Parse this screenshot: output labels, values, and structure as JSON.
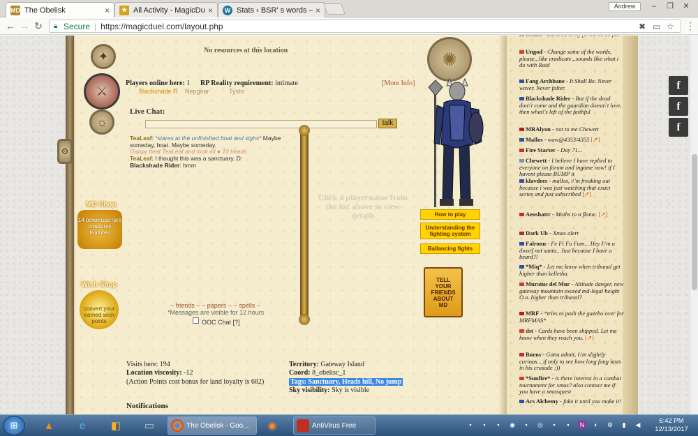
{
  "browser": {
    "tabs": [
      {
        "title": "The Obelisk",
        "icon": "magicduel-favicon"
      },
      {
        "title": "All Activity - MagicDuel F",
        "icon": "magicduel-favicon"
      },
      {
        "title": "Stats ‹ BSR' s words — W",
        "icon": "wordpress-icon"
      }
    ],
    "profile": "Andrew",
    "secure_label": "Secure",
    "url": "https://magicduel.com/layout.php"
  },
  "page": {
    "no_resources": "No resources at this location",
    "players_online_label": "Players online here:",
    "players_online_count": "1",
    "rp_label": "RP Reality requirement:",
    "rp_value": "intimate",
    "more_info": "[More Info]",
    "players": [
      "Blackshade R",
      "Nepgear",
      "Tyshr"
    ],
    "live_chat_label": "Live Chat:",
    "talk_label": "talk",
    "chat": [
      {
        "who": "TeaLeaf",
        "action": "*stares at the unfinished boat and sighs*",
        "text": " Maybe someday, boat. Maybe someday."
      },
      {
        "system": "Gappy beat TeaLeaf and took all ● 10 heads"
      },
      {
        "who": "TeaLeaf",
        "text": " I thought this was a sanctuary. D:"
      },
      {
        "who": "Blackshade Rider",
        "text": " hmm"
      }
    ],
    "click_hint": "Click a playername from the list above to view details",
    "friends_links": "~ friends ~ ~ papers ~ ~ spells ~",
    "messages_visible": "*Messages are visible for 12 hours",
    "ooc_label": "OOC Chat [?]",
    "md_shop": {
      "title": "MD Shop",
      "body": "14 powerups rare creatures features"
    },
    "wish_shop": {
      "title": "Wish Shop",
      "body": "convert your earned wish points"
    },
    "menu": {
      "how_to_play": "How to play",
      "fighting": "Understanding the fighting system",
      "ballancing": "Ballancing fights",
      "tell_friends": "TELL\nYOUR\nFRIENDS\nABOUT\nMD"
    },
    "location": {
      "visits": "Visits here: 194",
      "viscosity_label": "Location viscosity:",
      "viscosity_value": "-12",
      "ap_bonus": "(Action Points cost bonus for land loyalty is 682)",
      "territory_label": "Territory:",
      "territory_value": "Gateway Island",
      "coord_label": "Coord:",
      "coord_value": "8_obelisc_1",
      "tags": "Tags: Sanctuary, Heads hill, No jump",
      "sky_label": "Sky visibility:",
      "sky_value": "Sky is visible"
    },
    "notifications": "Notifications"
  },
  "activity": [
    {
      "name": "Ledah",
      "msg": "- Battered is my favourite so far.",
      "flag": "#c03030"
    },
    {
      "name": "Ungod",
      "msg": "- Change some of the words, please...like eradicate...sounds like what i do with Raid",
      "flag": "#d04030"
    },
    {
      "name": "Fang Archbane",
      "msg": "- It Shall Be. Never waver. Never falter.",
      "flag": "#3050a0"
    },
    {
      "name": "Blackshade Rider",
      "msg": "- But if the dead don\\'t come and the guardian doesn\\'t love, then what\\'s left of the faithful",
      "flag": "#3050a0"
    },
    {
      "name": "MRAlyon",
      "msg": "- not to me Chewett",
      "flag": "#b02020"
    },
    {
      "name": "Mallos",
      "msg": "- wow@4353/4355",
      "flag": "#3050a0",
      "ext": "[↗]"
    },
    {
      "name": "Fire Starter",
      "msg": "- Day 71...",
      "flag": "#c03030"
    },
    {
      "name": "Chewett",
      "msg": "- I believe I have replied to everyone on forum and ingame now! if I havent please BUMP it",
      "flag": "#8090c0"
    },
    {
      "name": "klavdees",
      "msg": "- mallos, i\\'m freaking out because i was just watching that exact series and just subscribed",
      "flag": "#3050a0",
      "ext": "[↗]"
    },
    {
      "name": "Aeoshattr",
      "msg": "- Moths to a flame.",
      "flag": "#c03030",
      "ext": "[↗]"
    },
    {
      "name": "Dark Ub",
      "msg": "- Xmas alert",
      "flag": "#a03030"
    },
    {
      "name": "Falronn",
      "msg": "- Fe Fi Fo Fum... Hey I\\'m a dwarf not santa.. Just because I have a beard?!",
      "flag": "#3050a0"
    },
    {
      "name": "*Miq*",
      "msg": "- Let me know when tribunal get higher than kelletha.",
      "flag": "#3050a0"
    },
    {
      "name": "Muratus del Mur",
      "msg": "- Altitude danger, new gateway mountain exceed md-legal height O.o..higher than tribunal?",
      "flag": "#c04040"
    },
    {
      "name": "MRF",
      "msg": "- *tries to push the gazebo over for MRFMAS*",
      "flag": "#b02020"
    },
    {
      "name": "dst",
      "msg": "- Cards have been shipped. Let me know when they reach you.",
      "flag": "#d04030",
      "ext": "[↗]"
    },
    {
      "name": "Burns",
      "msg": "- Gotta admit, i\\'m slightly curious... if only to see how long fang lasts in his crusade :))",
      "flag": "#c03030"
    },
    {
      "name": "*Sunfire*",
      "msg": "- is there interest in a combat tournament for xmas? also contact me if you have a xmasquest",
      "flag": "#d04030"
    },
    {
      "name": "Ars Alchemy",
      "msg": "- fake it until you make it!",
      "flag": "#3050a0"
    }
  ],
  "taskbar": {
    "tasks": [
      {
        "label": "The Obelisk - Goo...",
        "color": "#e0a020"
      },
      {
        "label": "AntiVirus Free",
        "color": "#c03020"
      }
    ],
    "time": "6:42 PM",
    "date": "12/13/2017"
  },
  "colors": {
    "accent": "#ffd400",
    "tags_highlight": "#3b87e2",
    "link": "#a0522d"
  }
}
